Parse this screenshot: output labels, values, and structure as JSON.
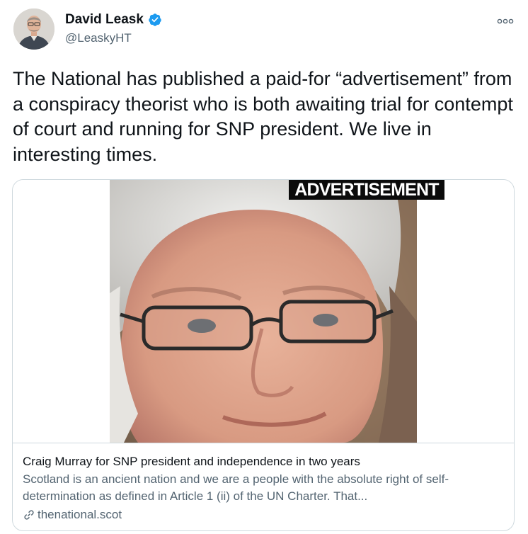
{
  "author": {
    "name": "David Leask",
    "handle": "@LeaskyHT",
    "verified": true
  },
  "tweet": {
    "text": "The National has published a paid-for “advertisement” from a conspiracy theorist who is both awaiting trial for contempt of court and running for SNP president. We live in interesting times."
  },
  "card": {
    "banner": "ADVERTISEMENT",
    "title": "Craig Murray for SNP president and independence in two years",
    "description": "Scotland is an ancient nation and we are a people with the absolute right of self-determination as defined in Article 1 (ii) of the UN Charter. That...",
    "domain": "thenational.scot"
  },
  "icons": {
    "verified": "verified-badge-icon",
    "more": "more-options-icon",
    "link": "link-icon"
  },
  "colors": {
    "text_primary": "#0f1419",
    "text_secondary": "#536471",
    "verified_blue": "#1d9bf0",
    "border": "#cfd9de"
  }
}
